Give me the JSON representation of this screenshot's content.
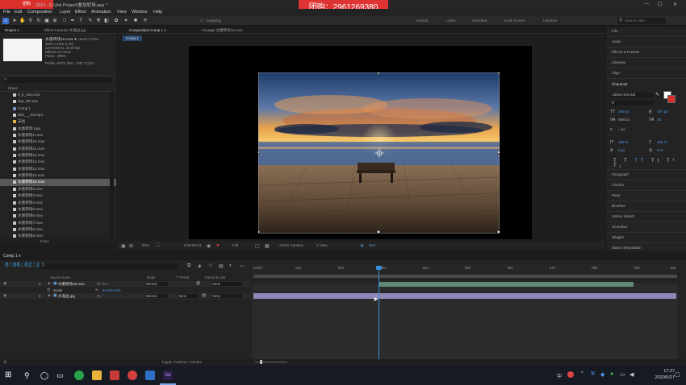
{
  "window": {
    "title": "2019 - E:\\Jnk Project\\叠加转场.aep *",
    "red_tag": "团购",
    "promo": "团购：2961269380",
    "controls": [
      "—",
      "☐",
      "✕"
    ]
  },
  "menu": [
    "File",
    "Edit",
    "Composition",
    "Layer",
    "Effect",
    "Animation",
    "View",
    "Window",
    "Help"
  ],
  "toolbar": {
    "snapping": "Snapping",
    "workspaces": [
      "Default",
      "Learn",
      "Standard",
      "Small Screen",
      "Libraries"
    ],
    "search_placeholder": "Search Help"
  },
  "project": {
    "tabs": [
      "Project ≡",
      "Effect Controls 大海边.jpg"
    ],
    "selected_name": "水墨转场16.mov ▾",
    "used": ", used 1 time",
    "info": [
      "3840 x 2160 (1.00)",
      "Δ 0:00:06:01, 25.00 fps",
      "Millions of Colors",
      "Photo - JPEG",
      "Profile: HDTV (Rec. 709) Y'CbCr"
    ],
    "column_name": "Name",
    "files": [
      "9_b_264.mov",
      "cbp_05.mov",
      "Comp 1",
      "dsK___03.mp4",
      "未找",
      "水墨转场.mp4",
      "水墨转场1.mov",
      "水墨转场10.mov",
      "水墨转场11.mov",
      "水墨转场12.mov",
      "水墨转场13.mov",
      "水墨转场14.mov",
      "水墨转场15.mov",
      "水墨转场16.mov",
      "水墨转场2.mov",
      "水墨转场3.mov",
      "水墨转场4.mov",
      "水墨转场5.mov",
      "水墨转场6.mov",
      "水墨转场7.mov",
      "水墨转场8.mov",
      "水墨转场9.mov"
    ],
    "selected_index": 13,
    "footer": "8 bpc"
  },
  "composition": {
    "tabs": [
      "Composition Comp 1 ≡",
      "Footage 水墨转场16.mov"
    ],
    "comp_tab": "Comp 1",
    "footer": {
      "zoom": "50%",
      "timecode": "0:00:02:24",
      "resolution": "Full",
      "camera": "Active Camera",
      "view": "1 View",
      "exposure": "+0.0"
    }
  },
  "right_panels": {
    "items": [
      "Info",
      "Audio",
      "Effects & Presets",
      "Libraries",
      "Align",
      "Character",
      "Paragraph",
      "Tracker",
      "Paint",
      "Brushes",
      "Motion Sketch",
      "Smoother",
      "Wiggler",
      "Mask Interpolation"
    ],
    "character": {
      "font": "Adobe Heiti Std",
      "style": "R",
      "size": "100 px",
      "leading": "107 px",
      "tracking": "Metrics",
      "kerning": "45",
      "stroke": "– px",
      "vscale": "100 %",
      "hscale": "100 %",
      "baseline": "0 px",
      "tsume": "0 %"
    }
  },
  "timeline": {
    "tab": "Comp 1 ≡",
    "timecode": "0:00:02:24",
    "ruler": [
      "0:00s",
      "01s",
      "02s",
      "03s",
      "04s",
      "05s",
      "06s",
      "07s",
      "08s",
      "09s",
      "10s"
    ],
    "headers": [
      "Source Name",
      "Mode",
      "T TrkMat",
      "Parent & Link"
    ],
    "layers": [
      {
        "num": "1",
        "name": "水墨转场16.mov",
        "mode": "Normal",
        "trkmat": "",
        "parent": "None"
      },
      {
        "num": "",
        "name": "Scale",
        "value": "54.0,54.0%"
      },
      {
        "num": "2",
        "name": "大海边.jpg",
        "mode": "Normal",
        "trkmat": "None",
        "parent": "None"
      }
    ],
    "footer": "Toggle Switches / Modes"
  },
  "taskbar": {
    "time": "17:27",
    "date": "2020/5/27",
    "lang": "中"
  },
  "colors": {
    "accent": "#3a8edb",
    "layer1_bar": "#5f8a76",
    "layer2_bar": "#8d88b8",
    "promo_red": "#e03434"
  }
}
